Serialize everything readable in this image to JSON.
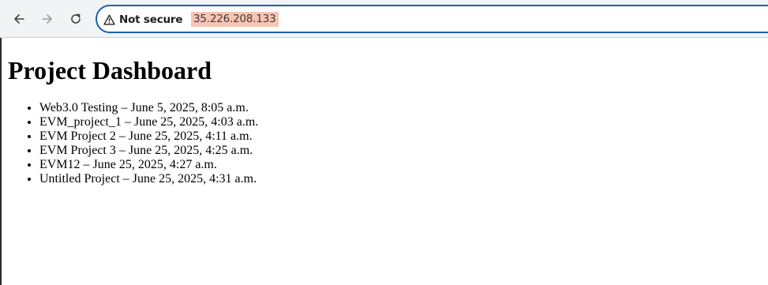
{
  "browser": {
    "security_label": "Not secure",
    "url": "35.226.208.133",
    "icons": {
      "back": "back-arrow-icon",
      "forward": "forward-arrow-icon",
      "reload": "reload-icon",
      "security": "warning-icon"
    },
    "colors": {
      "omnibox_border": "#1a5fb4",
      "url_highlight": "#f8c4b4",
      "toolbar_bg": "#f1f3f4"
    }
  },
  "page": {
    "title": "Project Dashboard",
    "projects": [
      "Web3.0 Testing – June 5, 2025, 8:05 a.m.",
      "EVM_project_1 – June 25, 2025, 4:03 a.m.",
      "EVM Project 2 – June 25, 2025, 4:11 a.m.",
      "EVM Project 3 – June 25, 2025, 4:25 a.m.",
      "EVM12 – June 25, 2025, 4:27 a.m.",
      "Untitled Project – June 25, 2025, 4:31 a.m."
    ]
  }
}
